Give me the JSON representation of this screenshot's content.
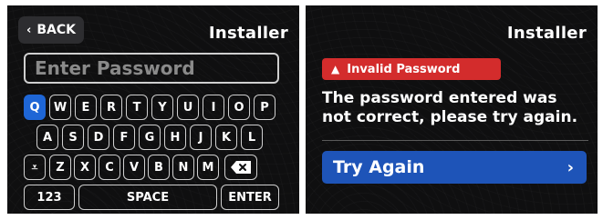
{
  "keyboard_screen": {
    "back_label": "BACK",
    "back_icon": "chevron-left-icon",
    "title": "Installer",
    "password_placeholder": "Enter Password",
    "keys_row1": [
      "Q",
      "W",
      "E",
      "R",
      "T",
      "Y",
      "U",
      "I",
      "O",
      "P"
    ],
    "keys_row2": [
      "A",
      "S",
      "D",
      "F",
      "G",
      "H",
      "J",
      "K",
      "L"
    ],
    "keys_row3": [
      "Z",
      "X",
      "C",
      "V",
      "B",
      "N",
      "M"
    ],
    "shift_icon": "caret-down-icon",
    "backspace_icon": "backspace-icon",
    "numbers_label": "123",
    "space_label": "SPACE",
    "enter_label": "ENTER",
    "selected_key": "Q",
    "accent_color": "#1e66d6"
  },
  "error_screen": {
    "title": "Installer",
    "alert_text": "Invalid Password",
    "alert_icon": "warning-icon",
    "alert_color": "#d32c2c",
    "message": "The password entered was not correct, please try again.",
    "try_again_label": "Try Again",
    "try_again_icon": "chevron-right-icon",
    "button_color": "#1e54b8"
  }
}
